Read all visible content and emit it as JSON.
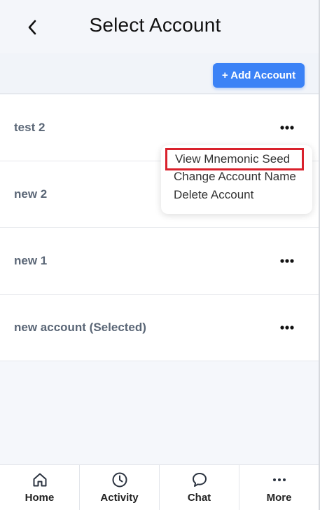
{
  "header": {
    "title": "Select Account",
    "back_icon": "chevron-left-icon"
  },
  "toolbar": {
    "add_account_label": "+ Add Account",
    "add_account_color": "#3b82f6"
  },
  "accounts": [
    {
      "name": "test 2",
      "menu_icon": "more-horizontal-icon"
    },
    {
      "name": "new 2",
      "menu_icon": "more-horizontal-icon"
    },
    {
      "name": "new 1",
      "menu_icon": "more-horizontal-icon"
    },
    {
      "name": "new account (Selected)",
      "menu_icon": "more-horizontal-icon"
    }
  ],
  "account_menu": {
    "items": [
      {
        "label": "View Mnemonic Seed",
        "highlighted": true
      },
      {
        "label": "Change Account Name",
        "highlighted": false
      },
      {
        "label": "Delete Account",
        "highlighted": false
      }
    ],
    "highlight_color": "#d9212c"
  },
  "bottom_nav": [
    {
      "label": "Home",
      "icon": "home-icon"
    },
    {
      "label": "Activity",
      "icon": "clock-icon"
    },
    {
      "label": "Chat",
      "icon": "chat-bubble-icon"
    },
    {
      "label": "More",
      "icon": "more-horizontal-icon"
    }
  ]
}
